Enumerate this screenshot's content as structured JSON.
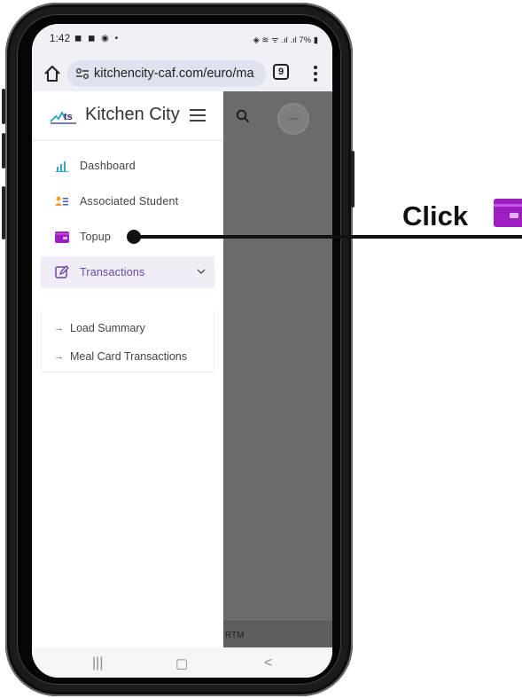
{
  "status_bar": {
    "time": "1:42",
    "left_icons": "◼ ◼ ◉ •",
    "right_icons": "◈ ≋ ᯤ .ıl .ıl 7% ▮"
  },
  "browser": {
    "url": "kitchencity-caf.com/euro/ma",
    "tab_count": "9"
  },
  "sidebar": {
    "brand": "Kitchen City",
    "items": [
      {
        "label": "Dashboard",
        "icon": "bar-chart-icon"
      },
      {
        "label": "Associated Student",
        "icon": "student-card-icon"
      },
      {
        "label": "Topup",
        "icon": "wallet-icon"
      },
      {
        "label": "Transactions",
        "icon": "edit-icon"
      }
    ],
    "submenu": [
      {
        "label": "Load Summary"
      },
      {
        "label": "Meal Card Transactions"
      }
    ]
  },
  "overlay": {
    "footer_text": "RTM"
  },
  "callout": {
    "text": "Click"
  },
  "colors": {
    "accent": "#6b46a4",
    "topup_icon": "#9d1fc2",
    "dashboard_icon": "#3aa7c9",
    "student_icon": "#f0a030",
    "overlay": "#6b6b6b"
  }
}
